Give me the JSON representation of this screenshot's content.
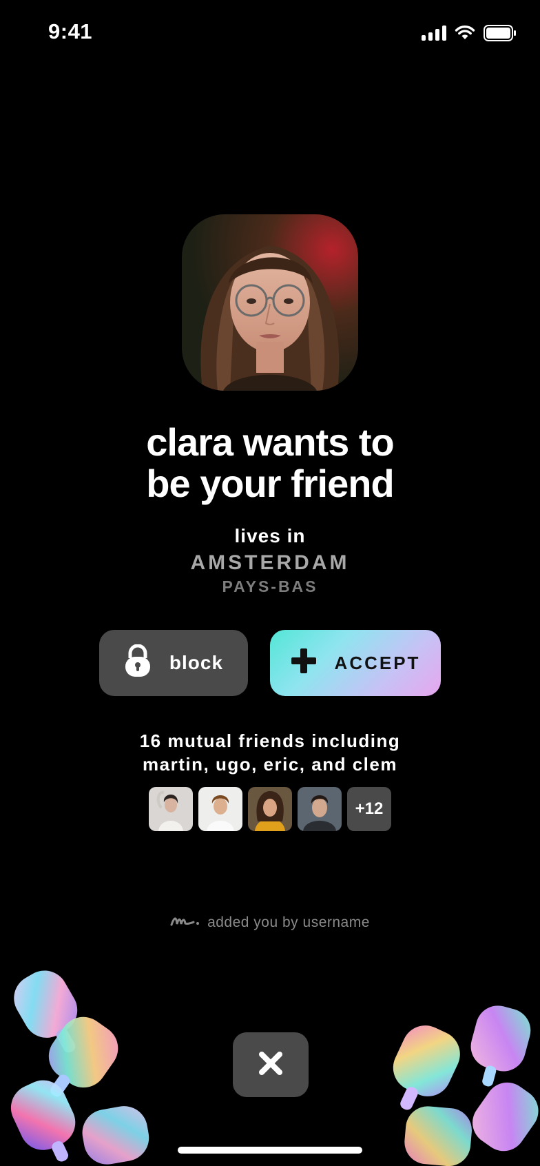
{
  "status_bar": {
    "time": "9:41"
  },
  "profile": {
    "headline_line1": "clara wants to",
    "headline_line2": "be your friend",
    "lives_label": "lives in",
    "city": "AMSTERDAM",
    "country": "PAYS-BAS"
  },
  "actions": {
    "block_label": "block",
    "accept_label": "ACCEPT"
  },
  "mutual": {
    "line1": "16 mutual friends including",
    "line2": "martin, ugo, eric, and clem",
    "more_count": "+12"
  },
  "footer": {
    "added_by": "added you by username"
  },
  "colors": {
    "background": "#000000",
    "button_dark": "#4a4a4a",
    "accept_gradient_start": "#54e6d6",
    "accept_gradient_end": "#e7a6ee",
    "muted_text": "#8a8a8a"
  },
  "icons": {
    "block": "lock-icon",
    "accept": "plus-icon",
    "close": "close-icon",
    "added_by": "signature-icon"
  }
}
